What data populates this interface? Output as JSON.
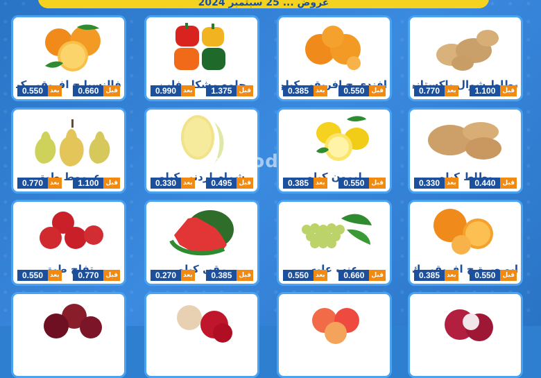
{
  "banner": {
    "text": "عروض ... 25 سبتمبر 2024"
  },
  "watermark": "al3rod.com",
  "labels": {
    "before": "قبل",
    "after": "بعد"
  },
  "products": [
    {
      "name": "بطاط شوال باكستانى",
      "old_price": "1.100",
      "new_price": "0.770",
      "icon": "potatoes-icon"
    },
    {
      "name": "افندى ج افريقى كيلو",
      "old_price": "0.550",
      "new_price": "0.385",
      "icon": "tangerines-icon"
    },
    {
      "name": "حلوه مشكل فلين",
      "old_price": "1.375",
      "new_price": "0.990",
      "icon": "bell-peppers-icon"
    },
    {
      "name": "فالنسيا ج افريقى كيلو",
      "old_price": "0.660",
      "new_price": "0.550",
      "icon": "oranges-icon"
    },
    {
      "name": "بطاط كيلو",
      "old_price": "0.440",
      "new_price": "0.330",
      "icon": "potatoes-icon"
    },
    {
      "name": "ليمون كيلو",
      "old_price": "0.550",
      "new_price": "0.385",
      "icon": "lemons-icon"
    },
    {
      "name": "شمام اردنى كيلو",
      "old_price": "0.495",
      "new_price": "0.330",
      "icon": "melon-icon"
    },
    {
      "name": "عرموط طبق",
      "old_price": "1.100",
      "new_price": "0.770",
      "icon": "pears-icon"
    },
    {
      "name": "ابو صرة ج افريقى ك",
      "old_price": "0.550",
      "new_price": "0.385",
      "icon": "navel-oranges-icon"
    },
    {
      "name": "عنب علبه",
      "old_price": "0.660",
      "new_price": "0.550",
      "icon": "grapes-icon"
    },
    {
      "name": "رقى كيلو",
      "old_price": "0.385",
      "new_price": "0.270",
      "icon": "watermelon-icon"
    },
    {
      "name": "تفاح طبق",
      "old_price": "0.770",
      "new_price": "0.550",
      "icon": "apples-icon"
    },
    {
      "name": "",
      "old_price": "",
      "new_price": "",
      "icon": "onions-icon"
    },
    {
      "name": "",
      "old_price": "",
      "new_price": "",
      "icon": "peaches-icon"
    },
    {
      "name": "",
      "old_price": "",
      "new_price": "",
      "icon": "pomegranates-icon"
    },
    {
      "name": "",
      "old_price": "",
      "new_price": "",
      "icon": "plums-icon"
    }
  ]
}
